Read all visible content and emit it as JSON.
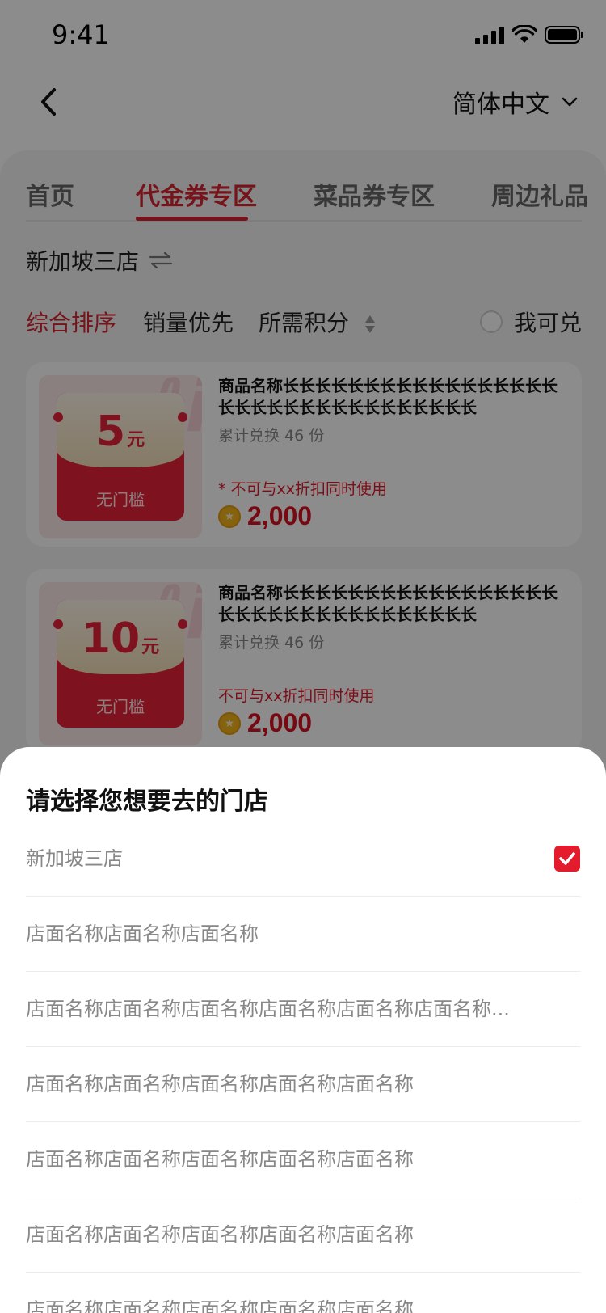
{
  "status_bar": {
    "time": "9:41"
  },
  "header": {
    "language": "简体中文"
  },
  "tabs": [
    {
      "label": "首页"
    },
    {
      "label": "代金券专区"
    },
    {
      "label": "菜品券专区"
    },
    {
      "label": "周边礼品"
    }
  ],
  "store": {
    "name": "新加坡三店"
  },
  "sort": {
    "comprehensive": "综合排序",
    "sales": "销量优先",
    "points": "所需积分",
    "redeemable": "我可兑"
  },
  "products": [
    {
      "name": "商品名称长长长长长长长长长长长长长长长长长长长长长长长长长长长长长长长长长",
      "sales": "累计兑换 46 份",
      "note": "* 不可与xx折扣同时使用",
      "points": "2,000",
      "coupon_amount": "5",
      "coupon_unit": "元",
      "coupon_condition": "无门槛"
    },
    {
      "name": "商品名称长长长长长长长长长长长长长长长长长长长长长长长长长长长长长长长长长",
      "sales": "累计兑换 46 份",
      "note": "不可与xx折扣同时使用",
      "points": "2,000",
      "coupon_amount": "10",
      "coupon_unit": "元",
      "coupon_condition": "无门槛"
    }
  ],
  "sheet": {
    "title": "请选择您想要去的门店",
    "stores": [
      {
        "name": "新加坡三店",
        "selected": true
      },
      {
        "name": "店面名称店面名称店面名称",
        "selected": false
      },
      {
        "name": "店面名称店面名称店面名称店面名称店面名称店面名称...",
        "selected": false
      },
      {
        "name": "店面名称店面名称店面名称店面名称店面名称",
        "selected": false
      },
      {
        "name": "店面名称店面名称店面名称店面名称店面名称",
        "selected": false
      },
      {
        "name": "店面名称店面名称店面名称店面名称店面名称",
        "selected": false
      },
      {
        "name": "店面名称店面名称店面名称店面名称店面名称",
        "selected": false
      }
    ]
  },
  "colors": {
    "accent": "#d92431",
    "overlay": "rgba(0,0,0,0.45)"
  }
}
